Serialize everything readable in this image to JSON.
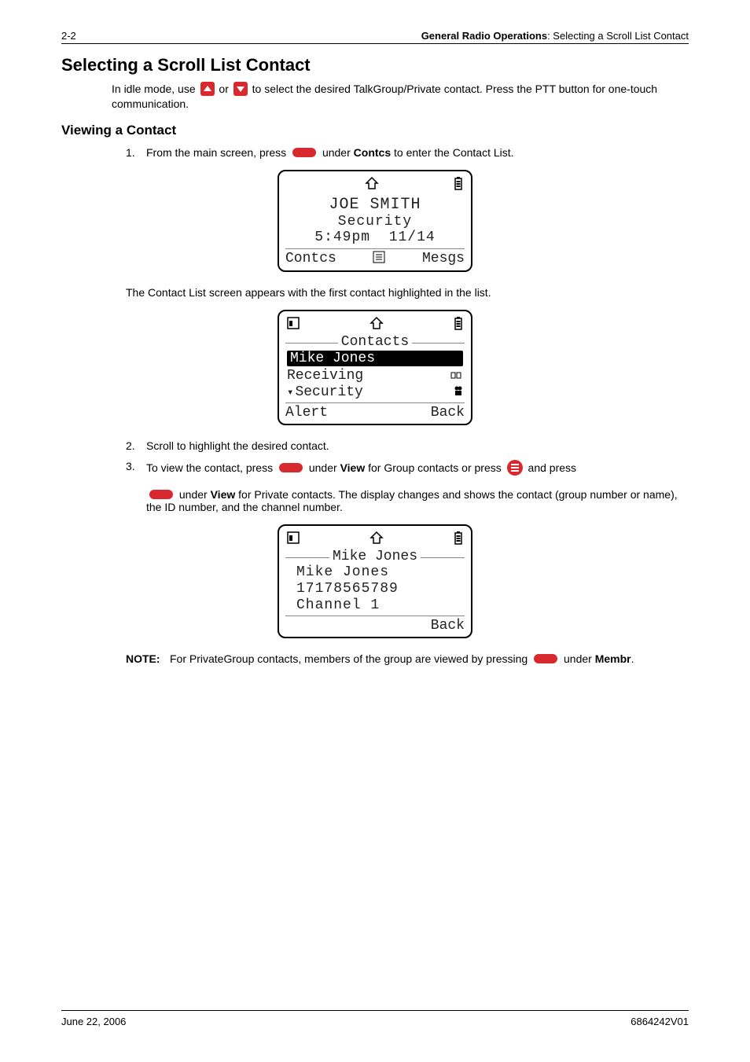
{
  "header": {
    "page_num": "2-2",
    "right_bold": "General Radio Operations",
    "right_sep": ": ",
    "right_rest": "Selecting a Scroll List Contact"
  },
  "section_title": "Selecting a Scroll List Contact",
  "intro_pre": "In idle mode, use ",
  "intro_mid": " or ",
  "intro_post": " to select the desired TalkGroup/Private contact. Press the PTT button for one-touch communication.",
  "subsection_title": "Viewing a Contact",
  "step1": {
    "num": "1.",
    "pre": "From the main screen, press ",
    "mid": " under ",
    "key": "Contcs",
    "post": " to enter the Contact List."
  },
  "lcd1": {
    "name": "JOE SMITH",
    "group": "Security",
    "time": "5:49pm",
    "date": "11/14",
    "soft_left": "Contcs",
    "soft_right": "Mesgs"
  },
  "caption1": "The Contact List screen appears with the first contact highlighted in the list.",
  "lcd2": {
    "title": "Contacts",
    "row1": "Mike Jones",
    "row2": "Receiving",
    "row3": "Security",
    "soft_left": "Alert",
    "soft_right": "Back"
  },
  "step2": {
    "num": "2.",
    "text": "Scroll to highlight the desired contact."
  },
  "step3": {
    "num": "3.",
    "p1a": "To view the contact, press ",
    "p1b": " under ",
    "view1": "View",
    "p1c": " for Group contacts or press ",
    "p1d": " and press",
    "p2a": " under ",
    "view2": "View",
    "p2b": " for Private contacts. The display changes and shows the contact (group number or name), the ID number, and the channel number."
  },
  "lcd3": {
    "title": "Mike Jones",
    "line1": "Mike Jones",
    "line2": "17178565789",
    "line3": "Channel 1",
    "soft_right": "Back"
  },
  "note": {
    "label": "NOTE:",
    "pre": "For PrivateGroup contacts, members of the group are viewed by pressing ",
    "mid": " under ",
    "key": "Membr",
    "post": "."
  },
  "footer": {
    "left": "June 22, 2006",
    "right": "6864242V01"
  }
}
